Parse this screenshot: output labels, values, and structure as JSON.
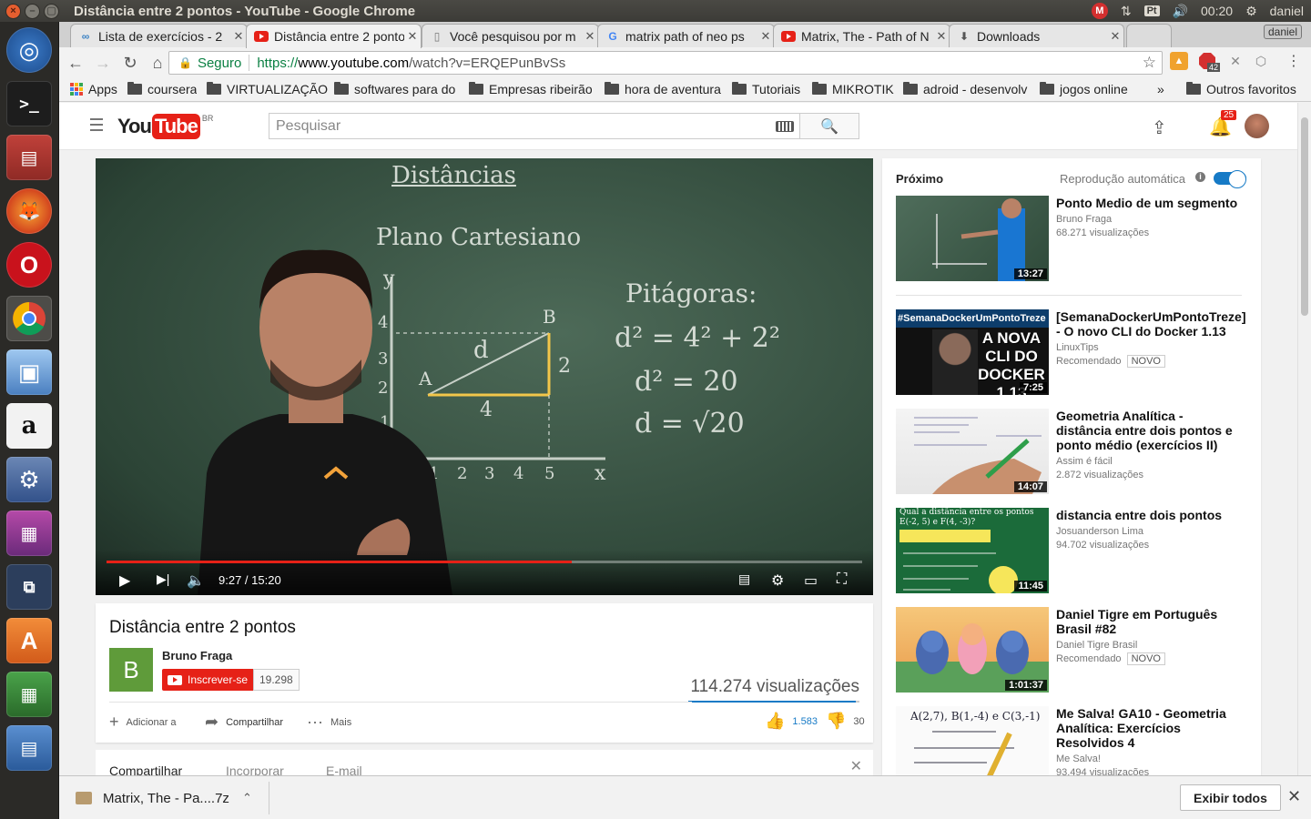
{
  "os": {
    "window_title": "Distância entre 2 pontos - YouTube - Google Chrome",
    "clock": "00:20",
    "user": "daniel",
    "keyboard_layout": "Pt",
    "tray_m": "M"
  },
  "launcher": {
    "icons": [
      "ubuntu-dash",
      "terminal",
      "file-manager",
      "firefox",
      "opera",
      "chrome",
      "virtualbox",
      "amazon",
      "system-settings",
      "workspace-switcher",
      "workspaces",
      "software-center",
      "libreoffice"
    ]
  },
  "browser": {
    "tabs": [
      {
        "title": "Lista de exercícios - 2",
        "favicon": "infinity"
      },
      {
        "title": "Distância entre 2 pontos",
        "favicon": "youtube",
        "active": true
      },
      {
        "title": "Você pesquisou por m",
        "favicon": "page"
      },
      {
        "title": "matrix path of neo ps",
        "favicon": "google"
      },
      {
        "title": "Matrix, The - Path of N",
        "favicon": "youtube"
      },
      {
        "title": "Downloads",
        "favicon": "download"
      }
    ],
    "profile_name": "daniel",
    "address": {
      "secure_label": "Seguro",
      "scheme": "https://",
      "host": "www.youtube.com",
      "path": "/watch?v=ERQEPunBvSs"
    },
    "extensions": {
      "abp_count": "42"
    },
    "bookmarks": [
      {
        "label": "Apps",
        "type": "apps"
      },
      {
        "label": "coursera",
        "type": "folder"
      },
      {
        "label": "VIRTUALIZAÇÃO",
        "type": "folder"
      },
      {
        "label": "softwares para do",
        "type": "folder"
      },
      {
        "label": "Empresas ribeirão",
        "type": "folder"
      },
      {
        "label": "hora de aventura",
        "type": "folder"
      },
      {
        "label": "Tutoriais",
        "type": "folder"
      },
      {
        "label": "MIKROTIK",
        "type": "folder"
      },
      {
        "label": "adroid - desenvolv",
        "type": "folder"
      },
      {
        "label": "jogos online",
        "type": "folder"
      }
    ],
    "bookmarks_overflow": "»",
    "other_bookmarks": "Outros favoritos"
  },
  "youtube": {
    "logo_you": "You",
    "logo_tube": "Tube",
    "region": "BR",
    "search_placeholder": "Pesquisar",
    "notifications_count": "25",
    "player": {
      "current_time": "9:27",
      "duration": "15:20",
      "time_display": "9:27 / 15:20",
      "progress": 0.616,
      "board_text": {
        "title": "Distâncias",
        "subtitle": "Plano Cartesiano",
        "theorem": "Pitágoras:",
        "eq1": "d² = 4² + 2²",
        "eq2": "d² = 20",
        "eq3": "d = √20",
        "axis_y": "y",
        "axis_x": "x",
        "point_a": "A",
        "point_b": "B",
        "seg_d": "d",
        "seg_4": "4",
        "seg_2": "2",
        "y_ticks": [
          "4",
          "3",
          "2",
          "1"
        ],
        "x_ticks": [
          "1",
          "2",
          "3",
          "4",
          "5"
        ]
      }
    },
    "video": {
      "title": "Distância entre 2 pontos",
      "channel_initial": "B",
      "channel": "Bruno Fraga",
      "subscribe_label": "Inscrever-se",
      "subscriber_count": "19.298",
      "views": "114.274 visualizações",
      "add_to": "Adicionar a",
      "share": "Compartilhar",
      "more": "Mais",
      "likes": "1.583",
      "dislikes": "30"
    },
    "share_tabs": [
      "Compartilhar",
      "Incorporar",
      "E-mail"
    ],
    "sidebar": {
      "next_label": "Próximo",
      "autoplay_label": "Reprodução automática",
      "recommendations": [
        {
          "title": "Ponto Medio de um segmento",
          "channel": "Bruno Fraga",
          "meta": "68.271 visualizações",
          "duration": "13:27"
        },
        {
          "title": "[SemanaDockerUmPontoTreze] - O novo CLI do Docker 1.13",
          "channel": "LinuxTips",
          "meta": "Recomendado",
          "badge": "NOVO",
          "duration": "7:25",
          "thumb_text": "#SemanaDockerUmPontoTreze",
          "thumb_big": "A NOVA CLI DO DOCKER 1.13"
        },
        {
          "title": "Geometria Analítica - distância entre dois pontos e ponto médio (exercícios II)",
          "channel": "Assim é fácil",
          "meta": "2.872 visualizações",
          "duration": "14:07"
        },
        {
          "title": "distancia entre dois pontos",
          "channel": "Josuanderson Lima",
          "meta": "94.702 visualizações",
          "duration": "11:45",
          "thumb_text": "Qual a distância entre os pontos E(-2, 5) e F(4, -3)?"
        },
        {
          "title": "Daniel Tigre em Português Brasil #82",
          "channel": "Daniel Tigre Brasil",
          "meta": "Recomendado",
          "badge": "NOVO",
          "duration": "1:01:37"
        },
        {
          "title": "Me Salva! GA10 - Geometria Analítica: Exercícios Resolvidos 4",
          "channel": "Me Salva!",
          "meta": "93.494 visualizações",
          "thumb_text": "A(2,7), B(1,-4) e C(3,-1)"
        }
      ]
    }
  },
  "downloads": {
    "file": "Matrix, The - Pa....7z",
    "show_all": "Exibir todos"
  },
  "colors": {
    "yt_red": "#e62117",
    "link_blue": "#167ac6",
    "secure_green": "#0b8043",
    "chalkboard": "#3d5a48",
    "channel_green": "#5f9b3a"
  }
}
